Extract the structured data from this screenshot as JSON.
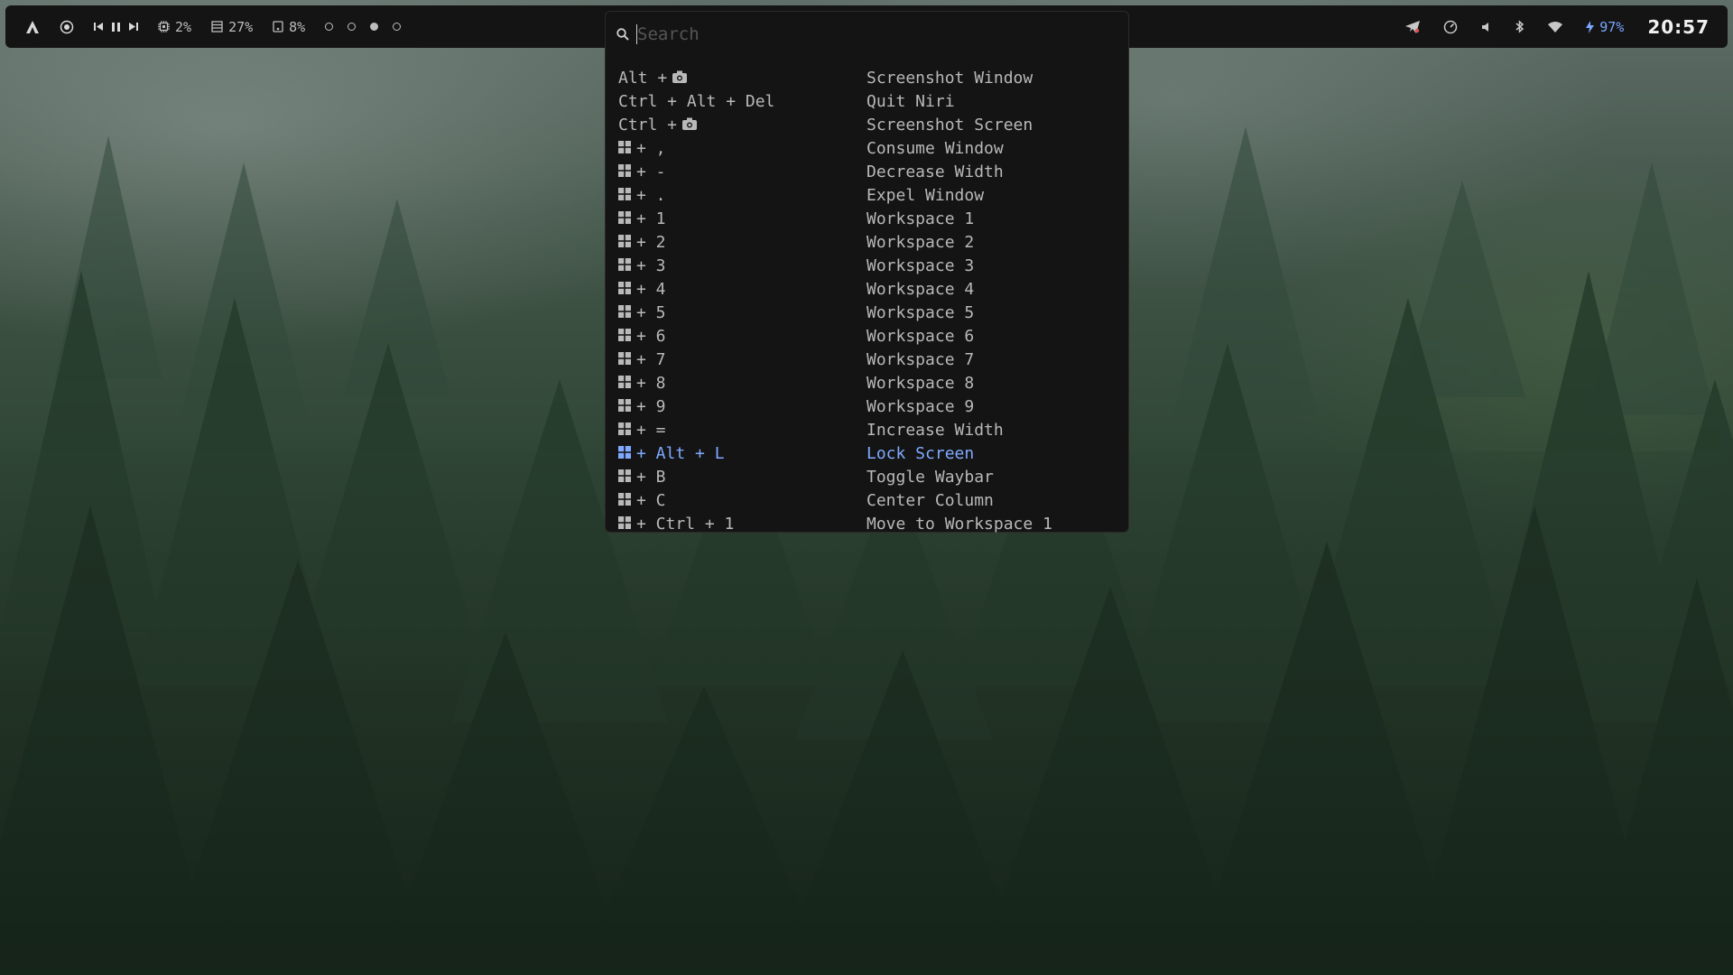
{
  "topbar": {
    "cpu": "2%",
    "memory": "27%",
    "disk": "8%",
    "workspaces": [
      false,
      false,
      true,
      false
    ],
    "battery": "97%",
    "clock": "20:57"
  },
  "launcher": {
    "search_placeholder": "Search",
    "selected_index": 16,
    "rows": [
      {
        "keys": "Alt +",
        "key_icon": "camera",
        "desc": "Screenshot Window"
      },
      {
        "keys": "Ctrl + Alt + Del",
        "desc": "Quit Niri"
      },
      {
        "keys": "Ctrl +",
        "key_icon": "camera",
        "desc": "Screenshot Screen"
      },
      {
        "keys": "+ ,",
        "mod_icon": "super",
        "desc": "Consume Window"
      },
      {
        "keys": "+ -",
        "mod_icon": "super",
        "desc": "Decrease Width"
      },
      {
        "keys": "+ .",
        "mod_icon": "super",
        "desc": "Expel Window"
      },
      {
        "keys": "+ 1",
        "mod_icon": "super",
        "desc": "Workspace 1"
      },
      {
        "keys": "+ 2",
        "mod_icon": "super",
        "desc": "Workspace 2"
      },
      {
        "keys": "+ 3",
        "mod_icon": "super",
        "desc": "Workspace 3"
      },
      {
        "keys": "+ 4",
        "mod_icon": "super",
        "desc": "Workspace 4"
      },
      {
        "keys": "+ 5",
        "mod_icon": "super",
        "desc": "Workspace 5"
      },
      {
        "keys": "+ 6",
        "mod_icon": "super",
        "desc": "Workspace 6"
      },
      {
        "keys": "+ 7",
        "mod_icon": "super",
        "desc": "Workspace 7"
      },
      {
        "keys": "+ 8",
        "mod_icon": "super",
        "desc": "Workspace 8"
      },
      {
        "keys": "+ 9",
        "mod_icon": "super",
        "desc": "Workspace 9"
      },
      {
        "keys": "+ =",
        "mod_icon": "super",
        "desc": "Increase Width"
      },
      {
        "keys": "+ Alt + L",
        "mod_icon": "super",
        "desc": "Lock Screen"
      },
      {
        "keys": "+ B",
        "mod_icon": "super",
        "desc": "Toggle Waybar"
      },
      {
        "keys": "+ C",
        "mod_icon": "super",
        "desc": "Center Column"
      },
      {
        "keys": "+ Ctrl + 1",
        "mod_icon": "super",
        "desc": "Move to Workspace 1"
      }
    ]
  },
  "colors": {
    "accent": "#80aaff",
    "panel_bg": "#141414",
    "text": "#b9b9b9"
  }
}
